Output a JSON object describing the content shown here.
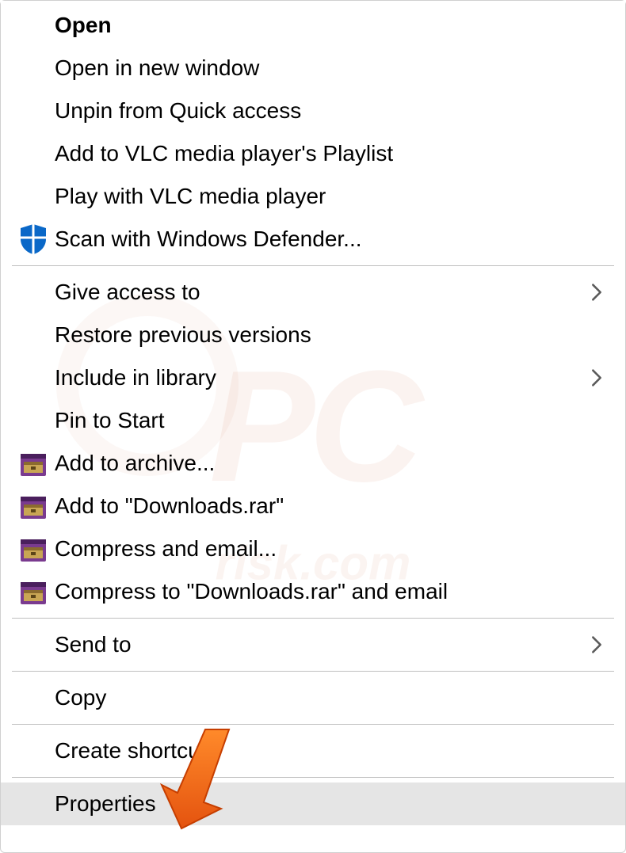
{
  "menu": {
    "groups": [
      {
        "items": [
          {
            "label": "Open",
            "bold": true,
            "icon": null,
            "submenu": false
          },
          {
            "label": "Open in new window",
            "bold": false,
            "icon": null,
            "submenu": false
          },
          {
            "label": "Unpin from Quick access",
            "bold": false,
            "icon": null,
            "submenu": false
          },
          {
            "label": "Add to VLC media player's Playlist",
            "bold": false,
            "icon": null,
            "submenu": false
          },
          {
            "label": "Play with VLC media player",
            "bold": false,
            "icon": null,
            "submenu": false
          },
          {
            "label": "Scan with Windows Defender...",
            "bold": false,
            "icon": "defender",
            "submenu": false
          }
        ]
      },
      {
        "items": [
          {
            "label": "Give access to",
            "bold": false,
            "icon": null,
            "submenu": true
          },
          {
            "label": "Restore previous versions",
            "bold": false,
            "icon": null,
            "submenu": false
          },
          {
            "label": "Include in library",
            "bold": false,
            "icon": null,
            "submenu": true
          },
          {
            "label": "Pin to Start",
            "bold": false,
            "icon": null,
            "submenu": false
          },
          {
            "label": "Add to archive...",
            "bold": false,
            "icon": "winrar",
            "submenu": false
          },
          {
            "label": "Add to \"Downloads.rar\"",
            "bold": false,
            "icon": "winrar",
            "submenu": false
          },
          {
            "label": "Compress and email...",
            "bold": false,
            "icon": "winrar",
            "submenu": false
          },
          {
            "label": "Compress to \"Downloads.rar\" and email",
            "bold": false,
            "icon": "winrar",
            "submenu": false
          }
        ]
      },
      {
        "items": [
          {
            "label": "Send to",
            "bold": false,
            "icon": null,
            "submenu": true
          }
        ]
      },
      {
        "items": [
          {
            "label": "Copy",
            "bold": false,
            "icon": null,
            "submenu": false
          }
        ]
      },
      {
        "items": [
          {
            "label": "Create shortcut",
            "bold": false,
            "icon": null,
            "submenu": false
          }
        ]
      },
      {
        "items": [
          {
            "label": "Properties",
            "bold": false,
            "icon": null,
            "submenu": false,
            "highlighted": true
          }
        ]
      }
    ]
  },
  "watermark": {
    "main": "PC",
    "sub": "risk.com"
  },
  "colors": {
    "arrow": "#ee6a1e",
    "highlight": "#e5e5e5",
    "defender_blue": "#0a68c8"
  }
}
